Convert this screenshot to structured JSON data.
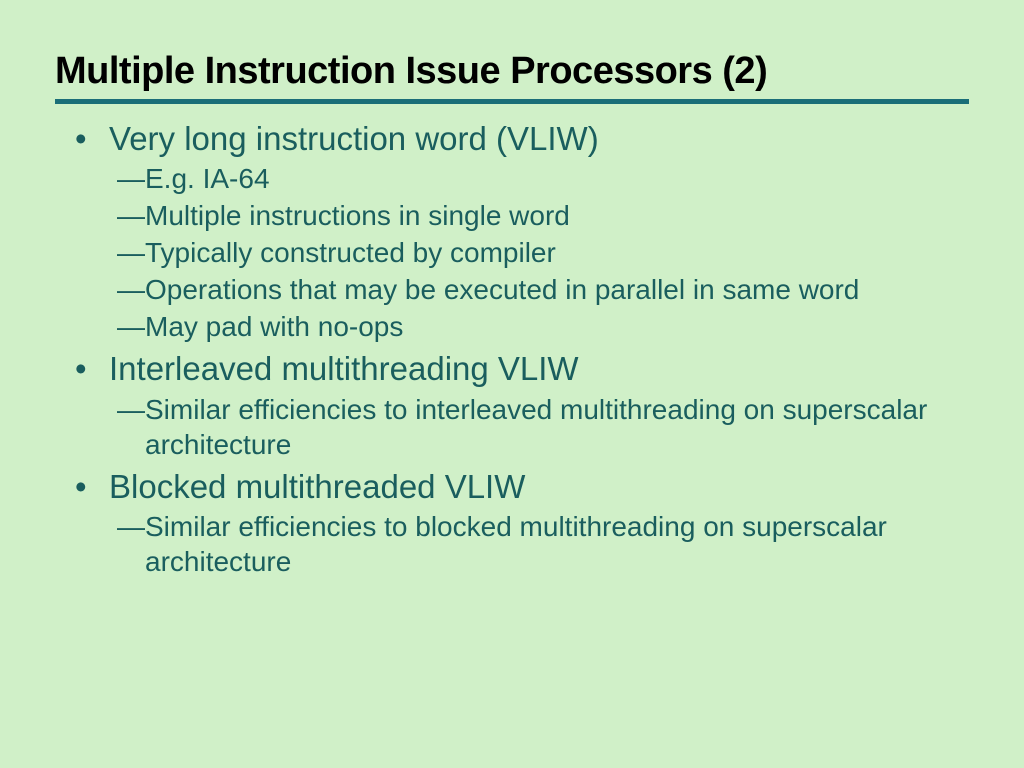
{
  "title": "Multiple Instruction Issue Processors (2)",
  "items": [
    {
      "text": "Very long instruction word (VLIW)",
      "subitems": [
        "E.g. IA-64",
        "Multiple instructions in single word",
        "Typically constructed by compiler",
        "Operations that may be executed in parallel in same word",
        "May pad with no-ops"
      ]
    },
    {
      "text": "Interleaved multithreading VLIW",
      "subitems": [
        "Similar efficiencies to interleaved multithreading on superscalar architecture"
      ]
    },
    {
      "text": "Blocked multithreaded VLIW",
      "subitems": [
        "Similar efficiencies to blocked multithreading on superscalar architecture"
      ]
    }
  ]
}
